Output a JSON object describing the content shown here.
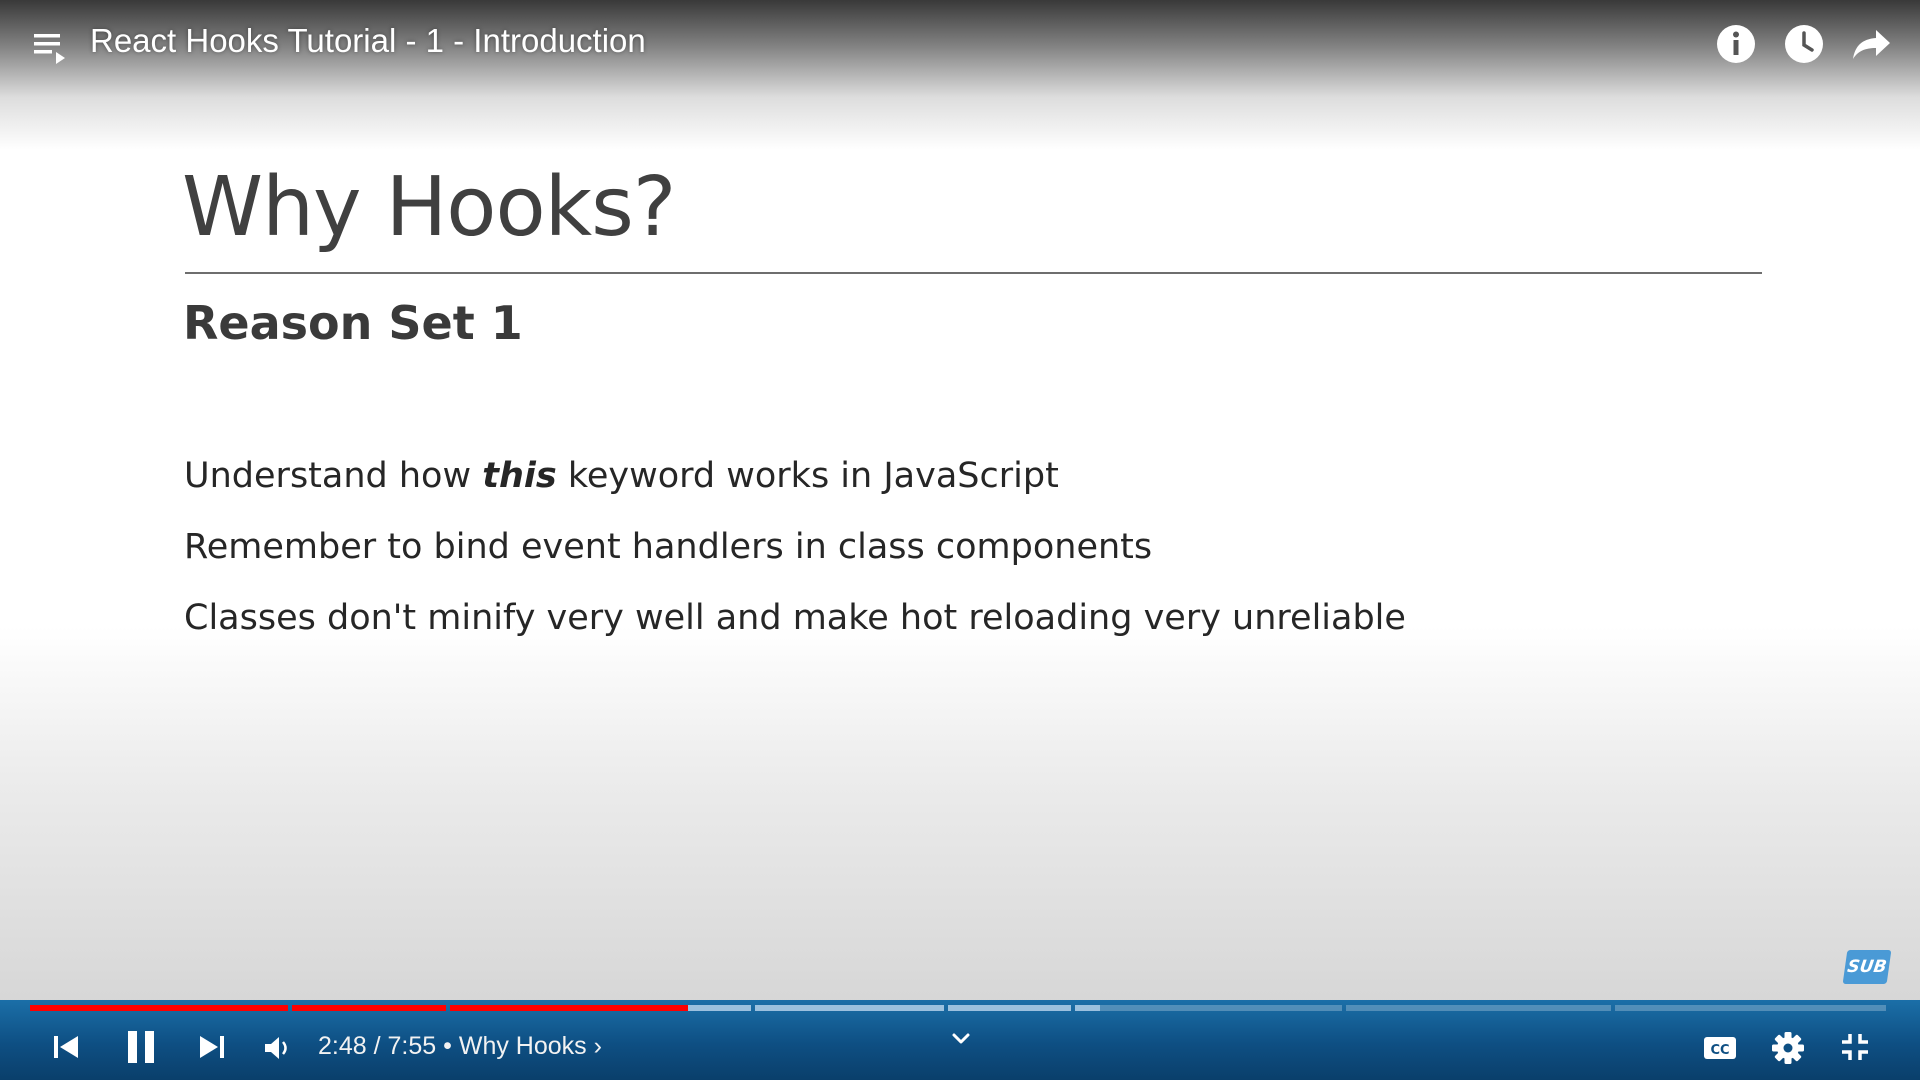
{
  "window": {
    "title": "React Hooks Tutorial - 1 - Introduction"
  },
  "top_actions": [
    {
      "name": "info-icon"
    },
    {
      "name": "watch-later-icon"
    },
    {
      "name": "share-icon"
    }
  ],
  "slide": {
    "title": "Why Hooks?",
    "subtitle": "Reason Set 1",
    "bullets": [
      {
        "before": "Understand how ",
        "keyword": "this",
        "after": " keyword works in JavaScript"
      },
      {
        "text": "Remember to bind event handlers in class components"
      },
      {
        "text": "Classes don't minify very well and make hot reloading very unreliable"
      }
    ]
  },
  "badge": {
    "text": "SUB"
  },
  "player": {
    "current_time": "2:48",
    "time_separator": " / ",
    "duration": "7:55",
    "chapter_separator": " • ",
    "chapter": "Why Hooks",
    "chapter_arrow": "›",
    "progress_fraction": 0.354,
    "buffered_fraction": 0.575,
    "chapter_count": 8,
    "colors": {
      "played": "#ff0000",
      "bar": "#0e4f83"
    }
  },
  "icons": {
    "playlist": "playlist-icon",
    "previous": "previous-icon",
    "pause": "pause-icon",
    "next": "next-icon",
    "volume": "volume-icon",
    "expand": "chevron-down-icon",
    "captions": "captions-icon",
    "settings": "gear-icon",
    "exit_fullscreen": "exit-fullscreen-icon"
  }
}
